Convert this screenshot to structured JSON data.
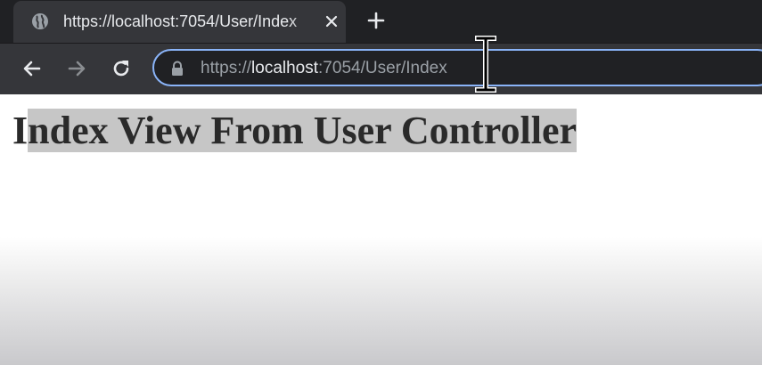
{
  "browser": {
    "tab": {
      "title": "https://localhost:7054/User/Index",
      "favicon_icon": "globe-icon",
      "close_icon": "close-icon"
    },
    "new_tab_icon": "plus-icon",
    "toolbar": {
      "back_icon": "arrow-left-icon",
      "forward_icon": "arrow-right-icon",
      "reload_icon": "reload-icon"
    },
    "address_bar": {
      "scheme": "https://",
      "host": "localhost",
      "rest": ":7054/User/Index",
      "lock_icon": "lock-icon",
      "focus_color": "#8ab4f8"
    }
  },
  "page": {
    "heading_first": "I",
    "heading_selected": "ndex View From User Controller",
    "selection_color": "#c6c6c6"
  }
}
